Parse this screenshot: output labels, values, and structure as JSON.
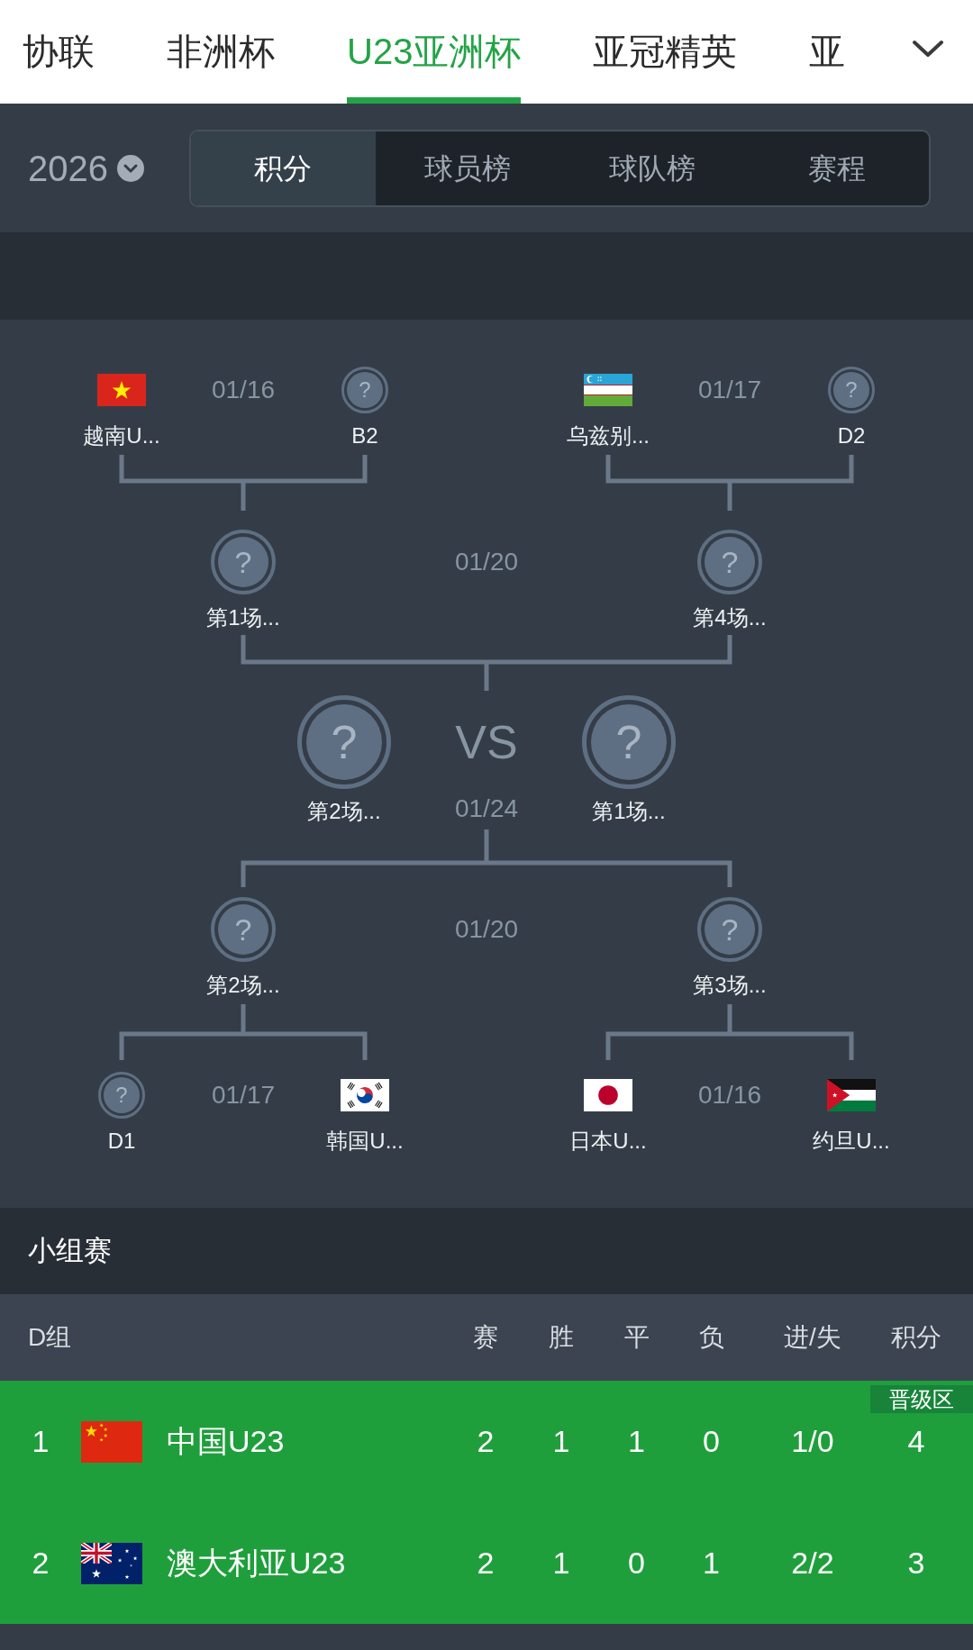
{
  "league_tabs": [
    {
      "label": "协联",
      "selected": false
    },
    {
      "label": "非洲杯",
      "selected": false
    },
    {
      "label": "U23亚洲杯",
      "selected": true
    },
    {
      "label": "亚冠精英",
      "selected": false
    },
    {
      "label": "亚",
      "selected": false
    }
  ],
  "season": {
    "year": "2026"
  },
  "view_tabs": [
    {
      "label": "积分",
      "selected": true
    },
    {
      "label": "球员榜",
      "selected": false
    },
    {
      "label": "球队榜",
      "selected": false
    },
    {
      "label": "赛程",
      "selected": false
    }
  ],
  "bracket": {
    "upper_quarterfinals": [
      {
        "date": "01/16",
        "teams": [
          {
            "kind": "flag_vn",
            "name": "越南U..."
          },
          {
            "kind": "unknown",
            "mark": "?",
            "name": "B2"
          }
        ]
      },
      {
        "date": "01/17",
        "teams": [
          {
            "kind": "flag_uz",
            "name": "乌兹别..."
          },
          {
            "kind": "unknown",
            "mark": "?",
            "name": "D2"
          }
        ]
      }
    ],
    "upper_semifinal": {
      "date": "01/20",
      "teams": [
        {
          "kind": "unknown",
          "mark": "?",
          "name": "第1场..."
        },
        {
          "kind": "unknown",
          "mark": "?",
          "name": "第4场..."
        }
      ]
    },
    "final": {
      "vs": "VS",
      "date": "01/24",
      "teams": [
        {
          "kind": "unknown",
          "mark": "?",
          "name": "第2场..."
        },
        {
          "kind": "unknown",
          "mark": "?",
          "name": "第1场..."
        }
      ]
    },
    "lower_semifinal": {
      "date": "01/20",
      "teams": [
        {
          "kind": "unknown",
          "mark": "?",
          "name": "第2场..."
        },
        {
          "kind": "unknown",
          "mark": "?",
          "name": "第3场..."
        }
      ]
    },
    "lower_quarterfinals": [
      {
        "date": "01/17",
        "teams": [
          {
            "kind": "unknown",
            "mark": "?",
            "name": "D1"
          },
          {
            "kind": "flag_kr",
            "name": "韩国U..."
          }
        ]
      },
      {
        "date": "01/16",
        "teams": [
          {
            "kind": "flag_jp",
            "name": "日本U..."
          },
          {
            "kind": "flag_jo",
            "name": "约旦U..."
          }
        ]
      }
    ]
  },
  "group_stage": {
    "title": "小组赛",
    "group": "D组",
    "columns": [
      "赛",
      "胜",
      "平",
      "负",
      "进/失",
      "积分"
    ],
    "rows": [
      {
        "rank": "1",
        "kind": "flag_cn",
        "team": "中国U23",
        "values": [
          "2",
          "1",
          "1",
          "0",
          "1/0",
          "4"
        ],
        "qualified": true,
        "badge": "晋级区"
      },
      {
        "rank": "2",
        "kind": "flag_au",
        "team": "澳大利亚U23",
        "values": [
          "2",
          "1",
          "0",
          "1",
          "2/2",
          "3"
        ],
        "qualified": true
      }
    ]
  }
}
